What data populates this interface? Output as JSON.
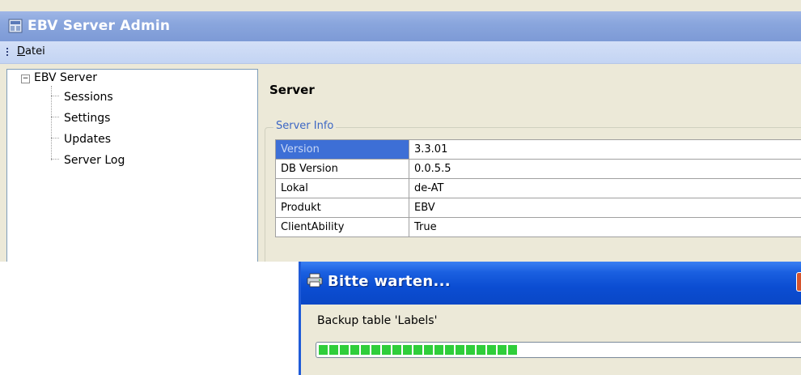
{
  "window": {
    "title": "EBV Server Admin"
  },
  "menu": {
    "items": [
      {
        "label_underline": "D",
        "label_rest": "atei"
      }
    ]
  },
  "tree": {
    "root": {
      "toggle": "−",
      "label": "EBV Server"
    },
    "children": [
      "Sessions",
      "Settings",
      "Updates",
      "Server Log"
    ]
  },
  "server": {
    "heading": "Server",
    "group_label": "Server Info",
    "rows": [
      {
        "key": "Version",
        "value": "3.3.01",
        "selected": true
      },
      {
        "key": "DB Version",
        "value": "0.0.5.5"
      },
      {
        "key": "Lokal",
        "value": "de-AT"
      },
      {
        "key": "Produkt",
        "value": "EBV"
      },
      {
        "key": "ClientAbility",
        "value": "True"
      }
    ]
  },
  "dialog": {
    "title": "Bitte warten...",
    "message": "Backup table 'Labels'",
    "progress_fraction": 0.39
  },
  "colors": {
    "main_titlebar": "#8aa6dd",
    "dialog_titlebar": "#0b4dd2",
    "selection": "#3d6fd6",
    "progress": "#2fce3a"
  },
  "icons": {
    "app": "server-window-icon",
    "dialog": "printer-icon",
    "close": "close-icon"
  }
}
